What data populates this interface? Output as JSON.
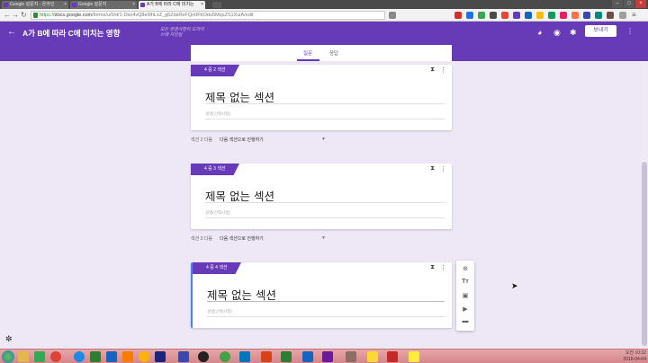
{
  "browser": {
    "tabs": [
      {
        "label": "Google 설문지 - 온라인"
      },
      {
        "label": "Google 설문지"
      },
      {
        "label": "A가 B에 따라 C에 미치는"
      }
    ],
    "address": {
      "scheme": "https://",
      "host": "docs.google.com",
      "path": "/forms/u/0/d/1-Dso4vQ8el9hLxZ_g6ZdsReFQn0FbOdu5MqxZS1XuiA/edit"
    }
  },
  "form": {
    "title": "A가 B에 따라 C에 미치는 영향",
    "saved_status": "모든 변경사항이 드라이브에 저장됨",
    "send_label": "보내기",
    "tabs": [
      "질문",
      "응답"
    ]
  },
  "sections": [
    {
      "label": "4 중 2 섹션",
      "title": "제목 없는 섹션",
      "description": "설명(선택사항)",
      "after_label": "섹션 2 다음",
      "after_value": "다음 섹션으로 진행하기"
    },
    {
      "label": "4 중 3 섹션",
      "title": "제목 없는 섹션",
      "description": "설명(선택사항)",
      "after_label": "섹션 3 다음",
      "after_value": "다음 섹션으로 진행하기"
    },
    {
      "label": "4 중 4 섹션",
      "title": "제목 없는 섹션",
      "description": "설명(선택사항)"
    }
  ],
  "toolbar_icons": [
    "add-question-icon",
    "add-title-icon",
    "add-image-icon",
    "add-video-icon",
    "add-section-icon"
  ],
  "tray": {
    "label": "오전",
    "time": "10:32",
    "date": "2018-04-04"
  },
  "colors": {
    "accent": "#673ab7",
    "background": "#ede7f6",
    "focus": "#4285f4"
  }
}
